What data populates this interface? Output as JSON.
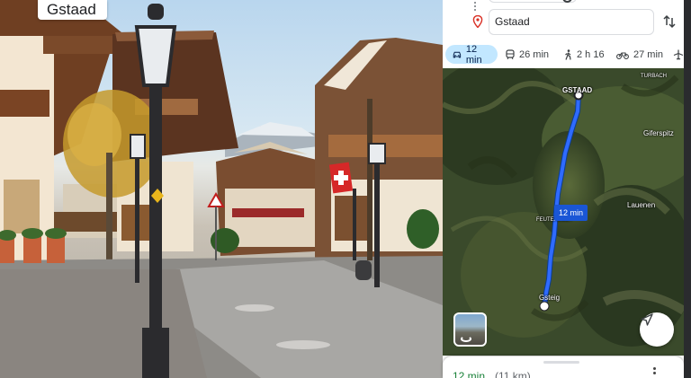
{
  "photo": {
    "place_label": "Gstaad"
  },
  "directions": {
    "destination_value": "Gstaad",
    "origin_icon": "origin-dots-icon",
    "destination_icon": "red-pin-icon",
    "swap_icon": "swap-vertical-icon"
  },
  "travel_modes": [
    {
      "icon": "car-icon",
      "label": "12 min",
      "active": true
    },
    {
      "icon": "transit-icon",
      "label": "26 min",
      "active": false
    },
    {
      "icon": "walk-icon",
      "label": "2 h 16",
      "active": false
    },
    {
      "icon": "bike-icon",
      "label": "27 min",
      "active": false
    },
    {
      "icon": "flight-icon",
      "label": "",
      "active": false
    }
  ],
  "map": {
    "labels": {
      "gstaad": "GSTAAD",
      "turbach": "TURBACH",
      "giferspitz": "Giferspitz",
      "lauenen": "Lauenen",
      "feutersoey": "FEUTERSOEY",
      "gsteig": "Gsteig"
    },
    "route_duration": "12 min",
    "route_color": "#1a56d6"
  },
  "summary": {
    "time": "12 min",
    "distance": "(11 km)"
  },
  "colors": {
    "accent": "#1a73e8",
    "active_mode_bg": "#c2e7ff",
    "summary_time": "#188038"
  }
}
